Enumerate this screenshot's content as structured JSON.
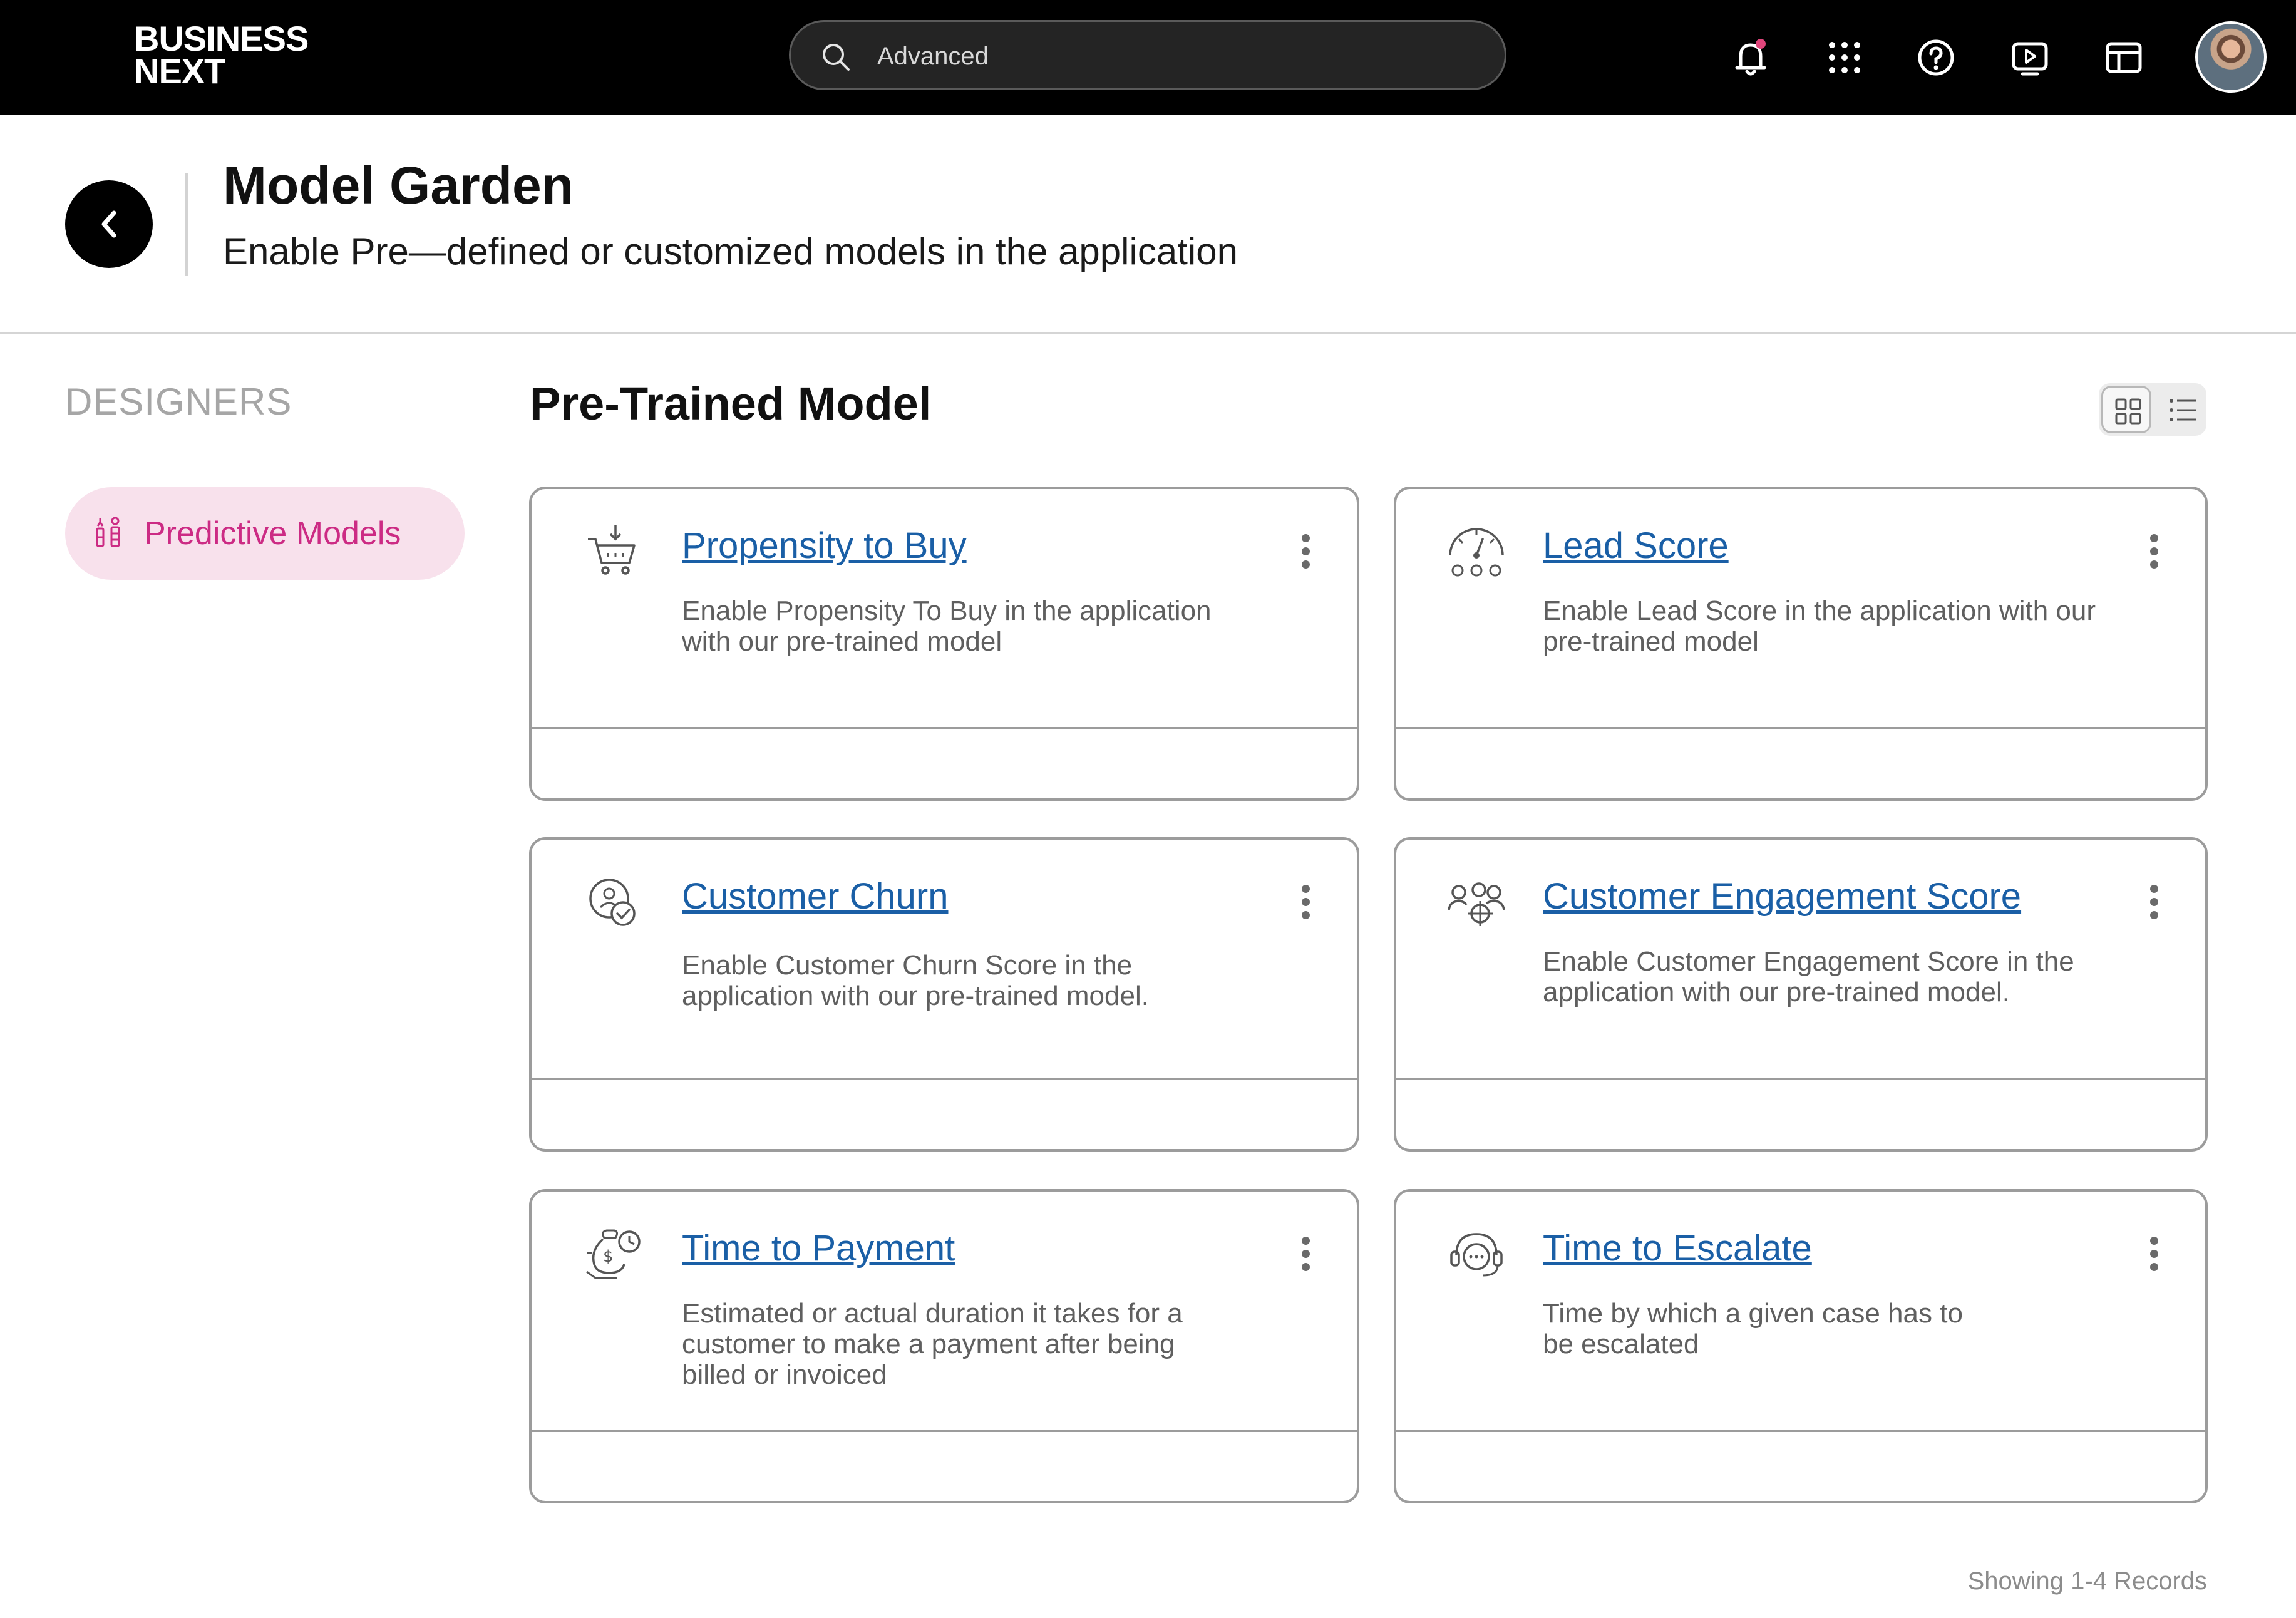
{
  "topbar": {
    "logo_line1": "BUSINESS",
    "logo_line2": "NEXT",
    "search_text": "Advanced",
    "icons": [
      "bell-icon",
      "apps-grid-icon",
      "help-icon",
      "video-icon",
      "layout-icon",
      "avatar"
    ],
    "notification_dot_color": "#e0457b"
  },
  "header": {
    "title": "Model Garden",
    "subtitle": "Enable Pre—defined or customized models in the application"
  },
  "sidebar": {
    "heading": "DESIGNERS",
    "items": [
      {
        "label": "Predictive Models",
        "icon": "predictive-models-icon",
        "active": true
      }
    ]
  },
  "main": {
    "title": "Pre-Trained Model",
    "view_toggle": {
      "active": "grid",
      "options": [
        "grid",
        "list"
      ]
    },
    "cards": [
      {
        "title": "Propensity to Buy",
        "description": "Enable Propensity To Buy in the application with our pre-trained model",
        "icon": "shopping-cart-icon"
      },
      {
        "title": "Lead Score",
        "description": "Enable Lead Score in the application with our pre-trained model",
        "icon": "gauge-icon"
      },
      {
        "title": "Customer Churn",
        "description": "Enable Customer Churn Score in the application with our pre-trained model.",
        "icon": "customer-churn-icon"
      },
      {
        "title": "Customer Engagement Score",
        "description": "Enable Customer Engagement Score in the application with our pre-trained model.",
        "icon": "engagement-icon"
      },
      {
        "title": "Time to Payment",
        "description": "Estimated or actual duration it takes for a customer to make a payment after being billed or invoiced",
        "icon": "money-clock-icon"
      },
      {
        "title": "Time to Escalate",
        "description": "Time by which a given case has to be escalated",
        "icon": "support-headset-icon"
      }
    ],
    "records_text": "Showing 1-4 Records"
  },
  "colors": {
    "accent_pink": "#cc2b84",
    "pill_bg": "#f8e1ec",
    "link_blue": "#1a5fa6",
    "topbar": "#000000"
  }
}
